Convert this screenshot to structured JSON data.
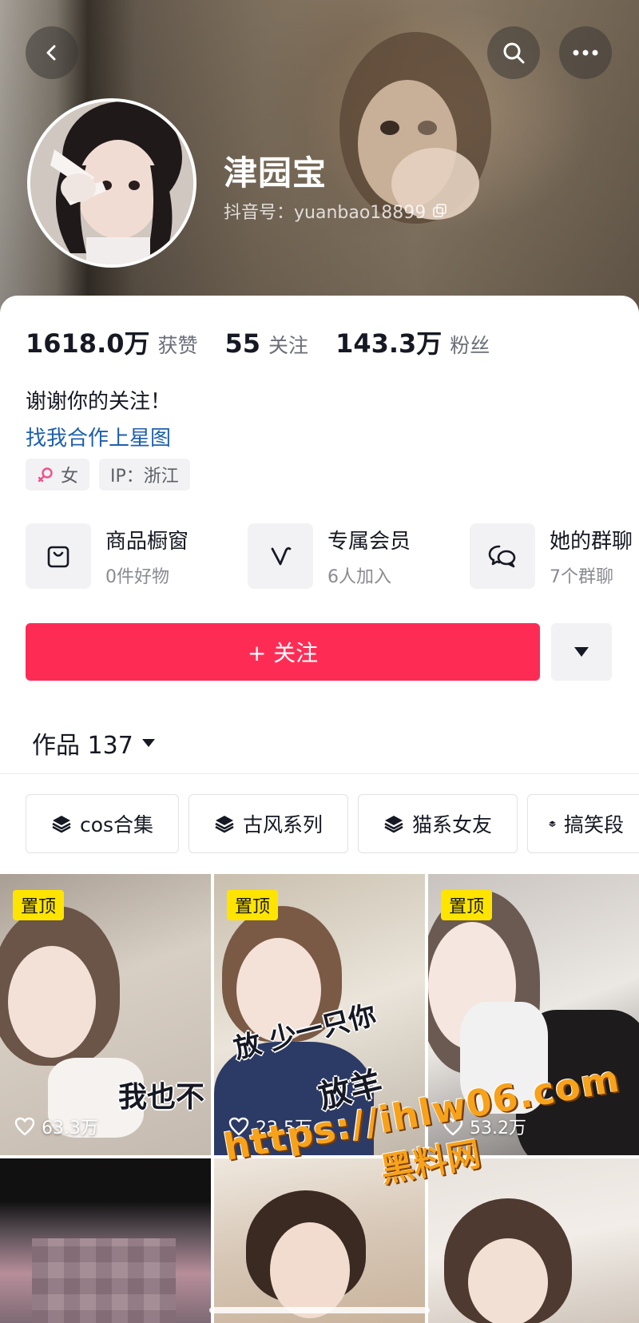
{
  "header": {
    "profile_name": "津园宝",
    "douyin_id": "抖音号：yuanbao18899",
    "icons": [
      "back-icon",
      "search-icon",
      "more-icon",
      "copy-icon"
    ]
  },
  "stats": [
    {
      "value": "1618.0万",
      "label": "获赞"
    },
    {
      "value": "55",
      "label": "关注"
    },
    {
      "value": "143.3万",
      "label": "粉丝"
    }
  ],
  "bio": {
    "text": "谢谢你的关注！",
    "link": "找我合作上星图"
  },
  "tags": [
    {
      "icon": "female-icon",
      "label": "女"
    },
    {
      "label": "IP：浙江"
    }
  ],
  "features": [
    {
      "icon": "shopping-bag-icon",
      "title": "商品橱窗",
      "subtitle": "0件好物"
    },
    {
      "icon": "membership-v-icon",
      "title": "专属会员",
      "subtitle": "6人加入"
    },
    {
      "icon": "group-chat-icon",
      "title": "她的群聊",
      "subtitle": "7个群聊"
    }
  ],
  "actions": {
    "follow_label": "+ 关注",
    "follow_color": "#fe2c55"
  },
  "works_tab": {
    "label": "作品 137"
  },
  "collections": [
    {
      "icon": "layers-icon",
      "label": "cos合集"
    },
    {
      "icon": "layers-icon",
      "label": "古风系列"
    },
    {
      "icon": "layers-icon",
      "label": "猫系女友"
    },
    {
      "icon": "layers-icon",
      "label": "搞笑段"
    }
  ],
  "videos": [
    {
      "pinned": "置顶",
      "likes": "63.3万",
      "caption": "我也不"
    },
    {
      "pinned": "置顶",
      "likes": "22.5万",
      "caption_line1": "放  少一只你",
      "caption_line2": "放羊"
    },
    {
      "pinned": "置顶",
      "likes": "53.2万"
    },
    {},
    {},
    {}
  ],
  "watermark": {
    "url": "https://ihlw06.com",
    "name": "黑料网"
  },
  "colors": {
    "accent": "#fe2c55",
    "link": "#1e5fae",
    "pin_badge": "#ffe400",
    "watermark": "#f7a21b"
  }
}
